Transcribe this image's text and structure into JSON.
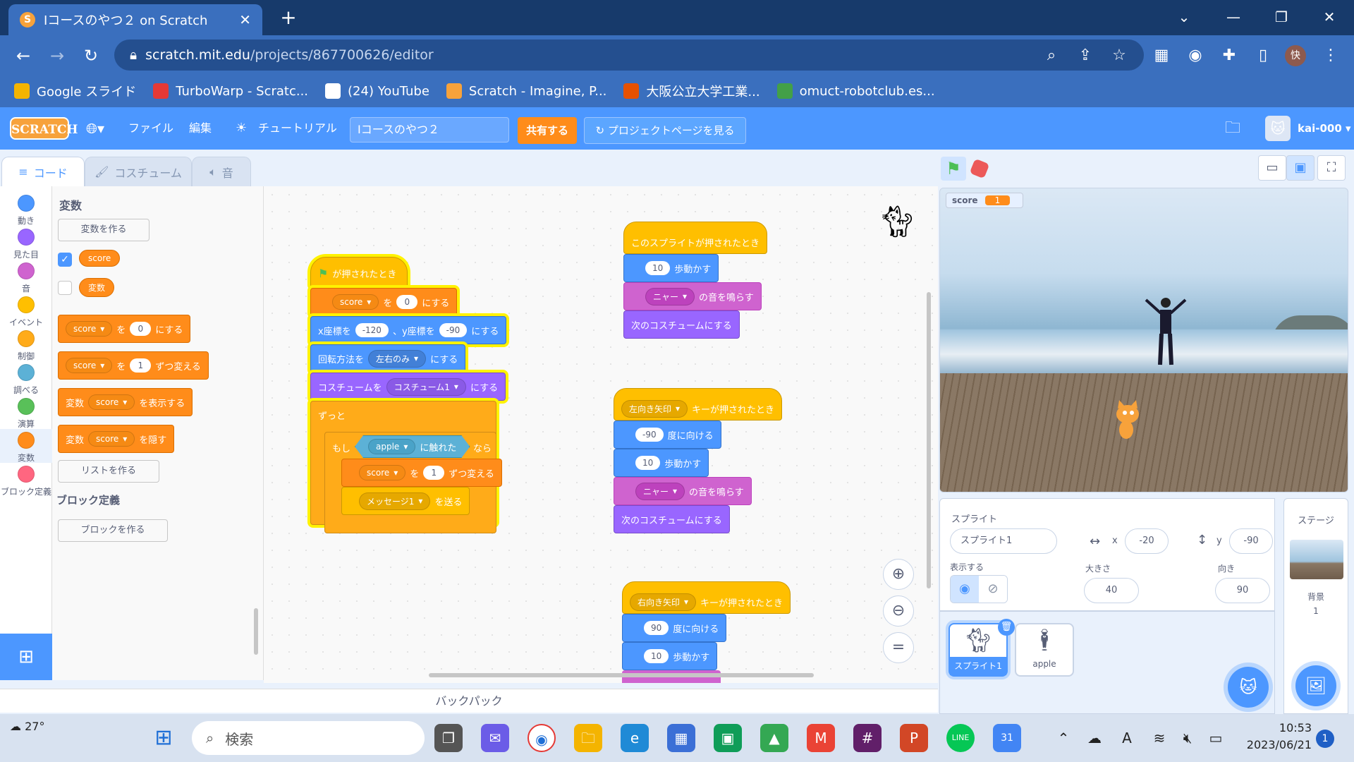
{
  "browser": {
    "tab_title": "Iコースのやつ２ on Scratch",
    "url_domain": "scratch.mit.edu",
    "url_path": "/projects/867700626/editor",
    "bookmarks": [
      {
        "label": "Google スライド",
        "color": "#f4b400"
      },
      {
        "label": "TurboWarp - Scratc...",
        "color": "#e53935"
      },
      {
        "label": "(24) YouTube",
        "color": "#ffffff"
      },
      {
        "label": "Scratch - Imagine, P...",
        "color": "#f7a23b"
      },
      {
        "label": "大阪公立大学工業...",
        "color": "#e65100"
      },
      {
        "label": "omuct-robotclub.es...",
        "color": "#43a047"
      }
    ]
  },
  "scratch": {
    "menu": {
      "file": "ファイル",
      "edit": "編集",
      "tutorial": "チュートリアル",
      "project_title": "Iコースのやつ２",
      "share": "共有する",
      "see_project": "プロジェクトページを見る",
      "username": "kai-000"
    },
    "tabs": {
      "code": "コード",
      "costume": "コスチューム",
      "sound": "音"
    },
    "categories": [
      {
        "label": "動き",
        "color": "#4c97ff"
      },
      {
        "label": "見た目",
        "color": "#9966ff"
      },
      {
        "label": "音",
        "color": "#cf63cf"
      },
      {
        "label": "イベント",
        "color": "#ffbf00"
      },
      {
        "label": "制御",
        "color": "#ffab19"
      },
      {
        "label": "調べる",
        "color": "#5cb1d6"
      },
      {
        "label": "演算",
        "color": "#59c059"
      },
      {
        "label": "変数",
        "color": "#ff8c1a"
      },
      {
        "label": "ブロック定義",
        "color": "#ff6680"
      }
    ],
    "palette": {
      "title": "変数",
      "make_var": "変数を作る",
      "var1": "score",
      "var2": "変数",
      "set_to": "を",
      "set_val": "0",
      "set_end": "にする",
      "change_val": "1",
      "change_end": "ずつ変える",
      "show_end": "を表示する",
      "hide_end": "を隠す",
      "make_list": "リストを作る",
      "my_blocks_title": "ブロック定義",
      "make_block": "ブロックを作る"
    },
    "script1": {
      "hat": "が押されたとき",
      "set_var": "score",
      "set_o": "を",
      "set_val": "0",
      "set_end": "にする",
      "goto_x_label": "x座標を",
      "goto_x": "-120",
      "goto_y_label": "、y座標を",
      "goto_y": "-90",
      "goto_end": "にする",
      "rot_label": "回転方法を",
      "rot_val": "左右のみ",
      "rot_end": "にする",
      "costume_label": "コスチュームを",
      "costume_val": "コスチューム1",
      "costume_end": "にする",
      "forever": "ずっと",
      "if_label": "もし",
      "touch_val": "apple",
      "touch_end": "に触れた",
      "if_end": "なら",
      "change_var": "score",
      "change_o": "を",
      "change_val": "1",
      "change_end": "ずつ変える",
      "msg_val": "メッセージ1",
      "msg_end": "を送る"
    },
    "script2": {
      "hat": "このスプライトが押されたとき",
      "move_val": "10",
      "move_end": "歩動かす",
      "sound_val": "ニャー",
      "sound_end": "の音を鳴らす",
      "next_costume": "次のコスチュームにする"
    },
    "script3": {
      "key": "左向き矢印",
      "hat_end": "キーが押されたとき",
      "dir_val": "-90",
      "dir_end": "度に向ける",
      "move_val": "10",
      "move_end": "歩動かす",
      "sound_val": "ニャー",
      "sound_end": "の音を鳴らす",
      "next_costume": "次のコスチュームにする"
    },
    "script4": {
      "key": "右向き矢印",
      "hat_end": "キーが押されたとき",
      "dir_val": "90",
      "dir_end": "度に向ける",
      "move_val": "10",
      "move_end": "歩動かす"
    },
    "backpack": "バックパック",
    "stage": {
      "monitor_label": "score",
      "monitor_value": "1"
    },
    "sprite_info": {
      "sprite_label": "スプライト",
      "sprite_name": "スプライト1",
      "x_label": "x",
      "x": "-20",
      "y_label": "y",
      "y": "-90",
      "show_label": "表示する",
      "size_label": "大きさ",
      "size": "40",
      "direction_label": "向き",
      "direction": "90"
    },
    "sprites": [
      "スプライト1",
      "apple"
    ],
    "stage_pane": {
      "title": "ステージ",
      "backdrop_label": "背景",
      "backdrop_count": "1"
    }
  },
  "taskbar": {
    "weather": "27°",
    "search_placeholder": "検索",
    "time": "10:53",
    "date": "2023/06/21",
    "notifications": "1"
  }
}
